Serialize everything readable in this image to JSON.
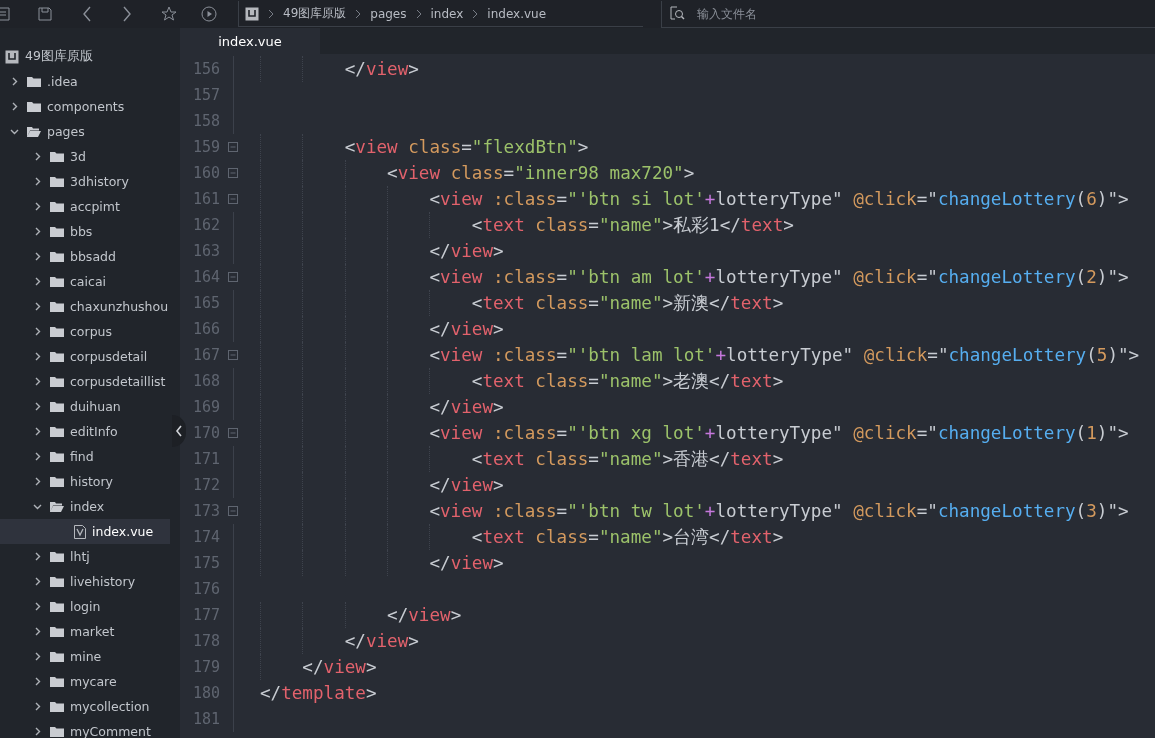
{
  "toolbar": {
    "breadcrumb": [
      "49图库原版",
      "pages",
      "index",
      "index.vue"
    ],
    "search": {
      "placeholder": "输入文件名"
    }
  },
  "tree": [
    {
      "label": "49图库原版",
      "kind": "project",
      "children": [
        {
          "label": ".idea",
          "kind": "folder",
          "expanded": false,
          "selected": false
        },
        {
          "label": "components",
          "kind": "folder",
          "expanded": false,
          "selected": false
        },
        {
          "label": "pages",
          "kind": "folder",
          "expanded": true,
          "selected": false,
          "children": [
            {
              "label": "3d",
              "kind": "folder",
              "expanded": false,
              "selected": false
            },
            {
              "label": "3dhistory",
              "kind": "folder",
              "expanded": false,
              "selected": false
            },
            {
              "label": "accpimt",
              "kind": "folder",
              "expanded": false,
              "selected": false
            },
            {
              "label": "bbs",
              "kind": "folder",
              "expanded": false,
              "selected": false
            },
            {
              "label": "bbsadd",
              "kind": "folder",
              "expanded": false,
              "selected": false
            },
            {
              "label": "caicai",
              "kind": "folder",
              "expanded": false,
              "selected": false
            },
            {
              "label": "chaxunzhushou",
              "kind": "folder",
              "expanded": false,
              "selected": false
            },
            {
              "label": "corpus",
              "kind": "folder",
              "expanded": false,
              "selected": false
            },
            {
              "label": "corpusdetail",
              "kind": "folder",
              "expanded": false,
              "selected": false
            },
            {
              "label": "corpusdetaillist",
              "kind": "folder",
              "expanded": false,
              "selected": false
            },
            {
              "label": "duihuan",
              "kind": "folder",
              "expanded": false,
              "selected": false
            },
            {
              "label": "editInfo",
              "kind": "folder",
              "expanded": false,
              "selected": false
            },
            {
              "label": "find",
              "kind": "folder",
              "expanded": false,
              "selected": false
            },
            {
              "label": "history",
              "kind": "folder",
              "expanded": false,
              "selected": false
            },
            {
              "label": "index",
              "kind": "folder",
              "expanded": true,
              "selected": false,
              "children": [
                {
                  "label": "index.vue",
                  "kind": "file",
                  "selected": true
                }
              ]
            },
            {
              "label": "lhtj",
              "kind": "folder",
              "expanded": false,
              "selected": false
            },
            {
              "label": "livehistory",
              "kind": "folder",
              "expanded": false,
              "selected": false
            },
            {
              "label": "login",
              "kind": "folder",
              "expanded": false,
              "selected": false
            },
            {
              "label": "market",
              "kind": "folder",
              "expanded": false,
              "selected": false
            },
            {
              "label": "mine",
              "kind": "folder",
              "expanded": false,
              "selected": false
            },
            {
              "label": "mycare",
              "kind": "folder",
              "expanded": false,
              "selected": false
            },
            {
              "label": "mycollection",
              "kind": "folder",
              "expanded": false,
              "selected": false
            },
            {
              "label": "myComment",
              "kind": "folder",
              "expanded": false,
              "selected": false
            }
          ]
        }
      ]
    }
  ],
  "tabs": [
    {
      "label": "index.vue",
      "selected": true
    }
  ],
  "editor": {
    "lines": [
      {
        "number": "156",
        "fold": false,
        "text": "        </view>"
      },
      {
        "number": "157",
        "fold": false
      },
      {
        "number": "158",
        "fold": false
      },
      {
        "number": "159",
        "fold": true,
        "text": "        <view class=\"flexdBtn\">"
      },
      {
        "number": "160",
        "fold": true,
        "text": "            <view class=\"inner98 max720\">"
      },
      {
        "number": "161",
        "fold": true,
        "text": "                <view :class=\"'btn si lot'+lotteryType\" @click=\"changeLottery(6)\">"
      },
      {
        "number": "162",
        "fold": false,
        "text": "                    <text class=\"name\">私彩1</text>"
      },
      {
        "number": "163",
        "fold": false,
        "text": "                </view>"
      },
      {
        "number": "164",
        "fold": true,
        "text": "                <view :class=\"'btn am lot'+lotteryType\" @click=\"changeLottery(2)\">"
      },
      {
        "number": "165",
        "fold": false,
        "text": "                    <text class=\"name\">新澳</text>"
      },
      {
        "number": "166",
        "fold": false,
        "text": "                </view>"
      },
      {
        "number": "167",
        "fold": true,
        "text": "                <view :class=\"'btn lam lot'+lotteryType\" @click=\"changeLottery(5)\">"
      },
      {
        "number": "168",
        "fold": false,
        "text": "                    <text class=\"name\">老澳</text>"
      },
      {
        "number": "169",
        "fold": false,
        "text": "                </view>"
      },
      {
        "number": "170",
        "fold": true,
        "text": "                <view :class=\"'btn xg lot'+lotteryType\" @click=\"changeLottery(1)\">"
      },
      {
        "number": "171",
        "fold": false,
        "text": "                    <text class=\"name\">香港</text>"
      },
      {
        "number": "172",
        "fold": false,
        "text": "                </view>"
      },
      {
        "number": "173",
        "fold": true,
        "text": "                <view :class=\"'btn tw lot'+lotteryType\" @click=\"changeLottery(3)\">"
      },
      {
        "number": "174",
        "fold": false,
        "text": "                    <text class=\"name\">台湾</text>"
      },
      {
        "number": "175",
        "fold": false,
        "text": "                </view>"
      },
      {
        "number": "176",
        "fold": false
      },
      {
        "number": "177",
        "fold": false,
        "text": "            </view>"
      },
      {
        "number": "178",
        "fold": false,
        "text": "        </view>"
      },
      {
        "number": "179",
        "fold": false,
        "text": "    </view>"
      },
      {
        "number": "180",
        "fold": false,
        "text": "</template>"
      },
      {
        "number": "181",
        "fold": false
      }
    ]
  }
}
